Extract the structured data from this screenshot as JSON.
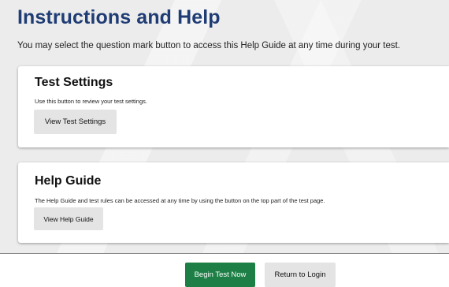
{
  "page": {
    "title": "Instructions and Help",
    "subtitle": "You may select the question mark button to access this Help Guide at any time during your test."
  },
  "sections": [
    {
      "title": "Test Settings",
      "description": "Use this button to review your test settings.",
      "button_label": "View Test Settings"
    },
    {
      "title": "Help Guide",
      "description": "The Help Guide and test rules can be accessed at any time by using the button on the top part of the test page.",
      "button_label": "View Help Guide"
    }
  ],
  "footer": {
    "begin_label": "Begin Test Now",
    "return_label": "Return to Login"
  },
  "colors": {
    "title": "#1f3d74",
    "begin_button": "#1d7f45",
    "secondary_button": "#e4e4e4"
  }
}
